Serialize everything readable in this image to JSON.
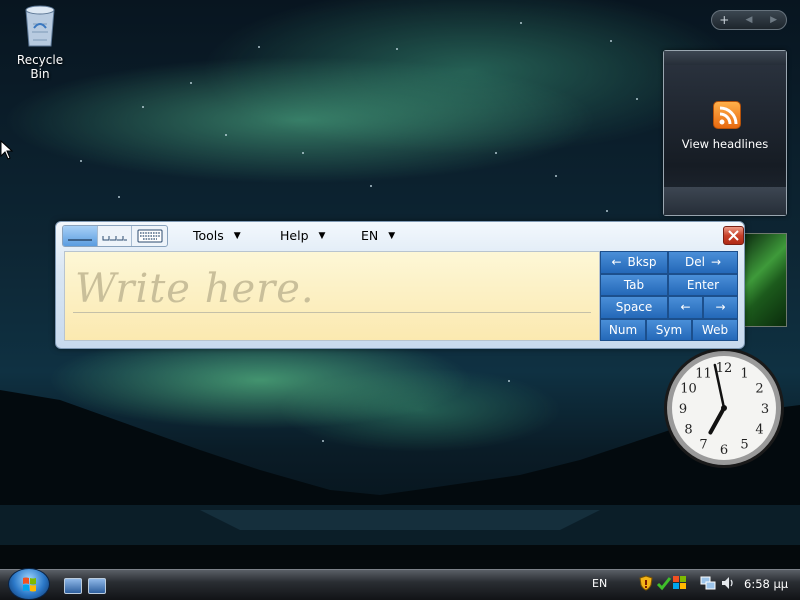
{
  "desktop": {
    "icons": [
      {
        "label": "Recycle Bin",
        "icon": "recycle-bin-icon"
      }
    ]
  },
  "sidebar": {
    "controls": {
      "add": "+",
      "prev": "◀",
      "next": "▶"
    },
    "feed_gadget": {
      "label": "View headlines",
      "icon": "rss-icon"
    },
    "clock_gadget": {
      "numbers": [
        "12",
        "1",
        "2",
        "3",
        "4",
        "5",
        "6",
        "7",
        "8",
        "9",
        "10",
        "11"
      ],
      "hour": 6,
      "minute": 58
    }
  },
  "input_panel": {
    "modes": [
      {
        "name": "writing-pad",
        "active": true
      },
      {
        "name": "character-pad",
        "active": false
      },
      {
        "name": "on-screen-keyboard",
        "active": false
      }
    ],
    "menus": {
      "tools": "Tools",
      "help": "Help",
      "language": "EN"
    },
    "placeholder": "Write here.",
    "keys": {
      "bksp": "Bksp",
      "del": "Del",
      "tab": "Tab",
      "enter": "Enter",
      "space": "Space",
      "left": "←",
      "right": "→",
      "num": "Num",
      "sym": "Sym",
      "web": "Web"
    },
    "colors": {
      "key": "#2f74c4",
      "pad": "#fcefc4"
    }
  },
  "taskbar": {
    "language": "EN",
    "time": "6:58 μμ"
  }
}
